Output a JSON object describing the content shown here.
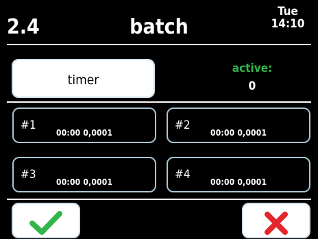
{
  "header": {
    "number": "2.4",
    "title": "batch",
    "day": "Tue",
    "time": "14:10"
  },
  "timer_button": {
    "label": "timer"
  },
  "active": {
    "label": "active:",
    "value": "0"
  },
  "slots": [
    {
      "label": "#1",
      "value": "00:00  0,0001"
    },
    {
      "label": "#2",
      "value": "00:00  0,0001"
    },
    {
      "label": "#3",
      "value": "00:00  0,0001"
    },
    {
      "label": "#4",
      "value": "00:00  0,0001"
    }
  ],
  "icons": {
    "confirm": "checkmark-icon",
    "cancel": "x-icon"
  },
  "colors": {
    "confirm": "#33b54a",
    "cancel": "#e3262b",
    "active_label": "#33b54a"
  }
}
